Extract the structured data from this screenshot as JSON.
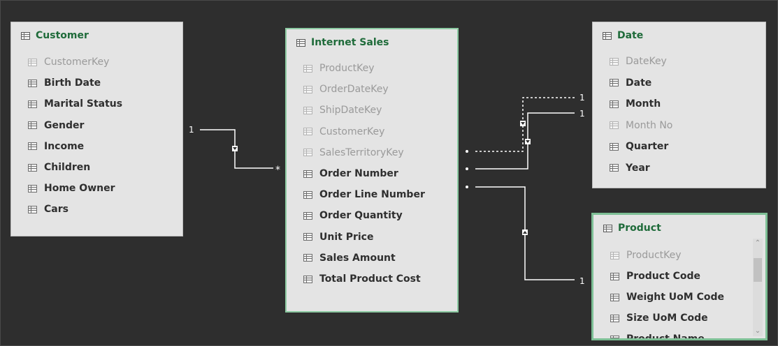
{
  "tables": {
    "customer": {
      "title": "Customer",
      "fields": [
        {
          "name": "CustomerKey",
          "hidden": true
        },
        {
          "name": "Birth Date",
          "hidden": false
        },
        {
          "name": "Marital Status",
          "hidden": false
        },
        {
          "name": "Gender",
          "hidden": false
        },
        {
          "name": "Income",
          "hidden": false
        },
        {
          "name": "Children",
          "hidden": false
        },
        {
          "name": "Home Owner",
          "hidden": false
        },
        {
          "name": "Cars",
          "hidden": false
        }
      ]
    },
    "internet_sales": {
      "title": "Internet Sales",
      "fields": [
        {
          "name": "ProductKey",
          "hidden": true
        },
        {
          "name": "OrderDateKey",
          "hidden": true
        },
        {
          "name": "ShipDateKey",
          "hidden": true
        },
        {
          "name": "CustomerKey",
          "hidden": true
        },
        {
          "name": "SalesTerritoryKey",
          "hidden": true
        },
        {
          "name": "Order Number",
          "hidden": false
        },
        {
          "name": "Order Line Number",
          "hidden": false
        },
        {
          "name": "Order Quantity",
          "hidden": false
        },
        {
          "name": "Unit Price",
          "hidden": false
        },
        {
          "name": "Sales Amount",
          "hidden": false
        },
        {
          "name": "Total Product Cost",
          "hidden": false
        }
      ]
    },
    "date": {
      "title": "Date",
      "fields": [
        {
          "name": "DateKey",
          "hidden": true
        },
        {
          "name": "Date",
          "hidden": false
        },
        {
          "name": "Month",
          "hidden": false
        },
        {
          "name": "Month No",
          "hidden": true
        },
        {
          "name": "Quarter",
          "hidden": false
        },
        {
          "name": "Year",
          "hidden": false
        }
      ]
    },
    "product": {
      "title": "Product",
      "fields": [
        {
          "name": "ProductKey",
          "hidden": true
        },
        {
          "name": "Product Code",
          "hidden": false
        },
        {
          "name": "Weight UoM  Code",
          "hidden": false
        },
        {
          "name": "Size UoM Code",
          "hidden": false
        },
        {
          "name": "Product Name",
          "hidden": false
        }
      ]
    }
  },
  "relationships": {
    "one_label": "1",
    "many_label": "*"
  },
  "colors": {
    "canvas": "#2e2e2e",
    "card": "#e4e4e4",
    "title": "#1f6b3a",
    "selected_border": "#7dbf95",
    "line": "#ffffff"
  }
}
